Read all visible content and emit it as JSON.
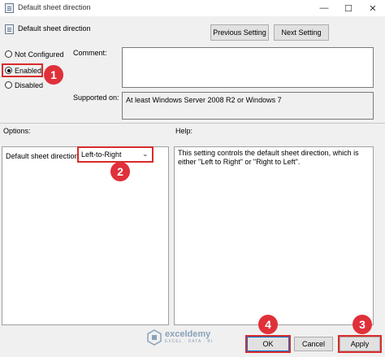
{
  "window": {
    "title": "Default sheet direction",
    "controls": {
      "minimize": "—",
      "maximize": "☐",
      "close": "✕"
    }
  },
  "header": {
    "setting_name": "Default sheet direction",
    "previous_setting_label": "Previous Setting",
    "next_setting_label": "Next Setting"
  },
  "state": {
    "options": [
      {
        "label": "Not Configured",
        "checked": false
      },
      {
        "label": "Enabled",
        "checked": true
      },
      {
        "label": "Disabled",
        "checked": false
      }
    ]
  },
  "comment": {
    "label": "Comment:",
    "value": ""
  },
  "supported": {
    "label": "Supported on:",
    "value": "At least Windows Server 2008 R2 or Windows 7"
  },
  "options_panel": {
    "label": "Options:",
    "field_label": "Default sheet direction",
    "selected_value": "Left-to-Right"
  },
  "help_panel": {
    "label": "Help:",
    "text": "This setting controls the default sheet direction, which is either \"Left to Right\" or \"Right to Left\"."
  },
  "footer": {
    "ok_label": "OK",
    "cancel_label": "Cancel",
    "apply_label": "Apply"
  },
  "annotations": {
    "step1": "1",
    "step2": "2",
    "step3": "3",
    "step4": "4",
    "highlight_color": "#d92b2b",
    "badge_color": "#e0303a"
  },
  "watermark": {
    "brand": "exceldemy",
    "tagline": "EXCEL · DATA · BI"
  }
}
